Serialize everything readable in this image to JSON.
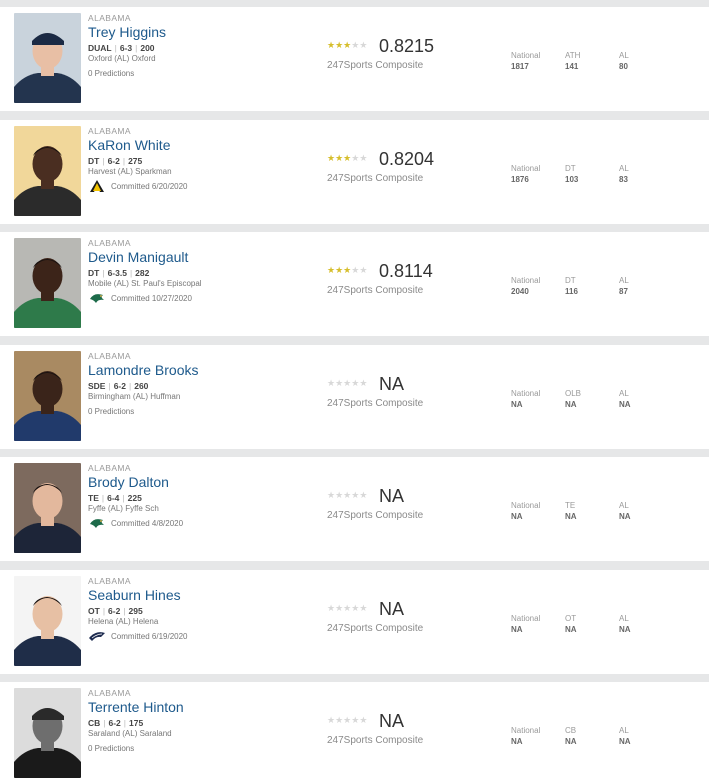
{
  "players": [
    {
      "state": "ALABAMA",
      "name": "Trey Higgins",
      "position": "DUAL",
      "height": "6-3",
      "weight": "200",
      "school": "Oxford (AL) Oxford",
      "status": "0 Predictions",
      "committed": false,
      "stars": 3,
      "rating": "0.8215",
      "composite_label": "247Sports Composite",
      "ranks": [
        {
          "label": "National",
          "value": "1817"
        },
        {
          "label": "ATH",
          "value": "141"
        },
        {
          "label": "AL",
          "value": "80"
        }
      ],
      "photo": {
        "bg": "#c9d3dc",
        "skin": "#e8bfa5",
        "shirt": "#23344e",
        "hat": "#1b2a44"
      }
    },
    {
      "state": "ALABAMA",
      "name": "KaRon White",
      "position": "DT",
      "height": "6-2",
      "weight": "275",
      "school": "Harvest (AL) Sparkman",
      "status": "Committed 6/20/2020",
      "committed": true,
      "logo": "app-state-logo",
      "stars": 3,
      "rating": "0.8204",
      "composite_label": "247Sports Composite",
      "ranks": [
        {
          "label": "National",
          "value": "1876"
        },
        {
          "label": "DT",
          "value": "103"
        },
        {
          "label": "AL",
          "value": "83"
        }
      ],
      "photo": {
        "bg": "#f1d79a",
        "skin": "#4a2e21",
        "shirt": "#2b2b2b",
        "hat": ""
      }
    },
    {
      "state": "ALABAMA",
      "name": "Devin Manigault",
      "position": "DT",
      "height": "6-3.5",
      "weight": "282",
      "school": "Mobile (AL) St. Paul's Episcopal",
      "status": "Committed 10/27/2020",
      "committed": true,
      "logo": "uab-logo",
      "stars": 3,
      "rating": "0.8114",
      "composite_label": "247Sports Composite",
      "ranks": [
        {
          "label": "National",
          "value": "2040"
        },
        {
          "label": "DT",
          "value": "116"
        },
        {
          "label": "AL",
          "value": "87"
        }
      ],
      "photo": {
        "bg": "#b8b8b4",
        "skin": "#3c2419",
        "shirt": "#2e7a4a",
        "hat": ""
      }
    },
    {
      "state": "ALABAMA",
      "name": "Lamondre Brooks",
      "position": "SDE",
      "height": "6-2",
      "weight": "260",
      "school": "Birmingham (AL) Huffman",
      "status": "0 Predictions",
      "committed": false,
      "stars": 0,
      "rating": "NA",
      "composite_label": "247Sports Composite",
      "ranks": [
        {
          "label": "National",
          "value": "NA"
        },
        {
          "label": "OLB",
          "value": "NA"
        },
        {
          "label": "AL",
          "value": "NA"
        }
      ],
      "photo": {
        "bg": "#a98a62",
        "skin": "#3a241a",
        "shirt": "#213a6b",
        "hat": ""
      }
    },
    {
      "state": "ALABAMA",
      "name": "Brody Dalton",
      "position": "TE",
      "height": "6-4",
      "weight": "225",
      "school": "Fyffe (AL) Fyffe Sch",
      "status": "Committed 4/8/2020",
      "committed": true,
      "logo": "uab-logo",
      "stars": 0,
      "rating": "NA",
      "composite_label": "247Sports Composite",
      "ranks": [
        {
          "label": "National",
          "value": "NA"
        },
        {
          "label": "TE",
          "value": "NA"
        },
        {
          "label": "AL",
          "value": "NA"
        }
      ],
      "photo": {
        "bg": "#7d6a5e",
        "skin": "#e3b89d",
        "shirt": "#1d2538",
        "hat": ""
      }
    },
    {
      "state": "ALABAMA",
      "name": "Seaburn Hines",
      "position": "OT",
      "height": "6-2",
      "weight": "295",
      "school": "Helena (AL) Helena",
      "status": "Committed 6/19/2020",
      "committed": true,
      "logo": "georgia-southern-logo",
      "stars": 0,
      "rating": "NA",
      "composite_label": "247Sports Composite",
      "ranks": [
        {
          "label": "National",
          "value": "NA"
        },
        {
          "label": "OT",
          "value": "NA"
        },
        {
          "label": "AL",
          "value": "NA"
        }
      ],
      "photo": {
        "bg": "#f4f4f4",
        "skin": "#e7c0a4",
        "shirt": "#1f2d48",
        "hat": ""
      }
    },
    {
      "state": "ALABAMA",
      "name": "Terrente Hinton",
      "position": "CB",
      "height": "6-2",
      "weight": "175",
      "school": "Saraland (AL) Saraland",
      "status": "0 Predictions",
      "committed": false,
      "stars": 0,
      "rating": "NA",
      "composite_label": "247Sports Composite",
      "ranks": [
        {
          "label": "National",
          "value": "NA"
        },
        {
          "label": "CB",
          "value": "NA"
        },
        {
          "label": "AL",
          "value": "NA"
        }
      ],
      "photo": {
        "bg": "#dcdcdc",
        "skin": "#6e6e6e",
        "shirt": "#1a1a1a",
        "hat": "#2a2a2a"
      }
    }
  ]
}
